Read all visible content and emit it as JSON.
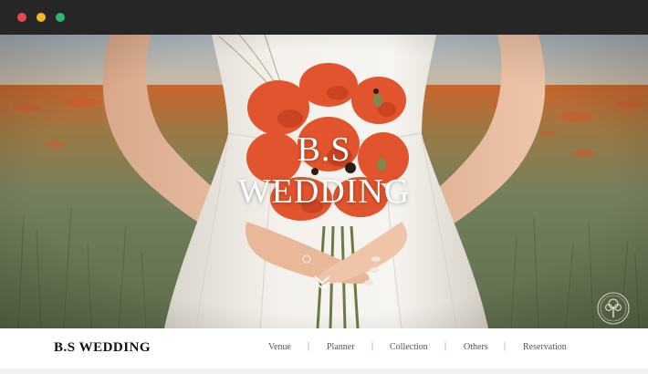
{
  "window": {
    "controls": [
      {
        "name": "close",
        "color": "#e8484a"
      },
      {
        "name": "minimize",
        "color": "#f5b727"
      },
      {
        "name": "zoom",
        "color": "#2fb573"
      }
    ]
  },
  "hero": {
    "title_line1": "B.S",
    "title_line2": "WEDDING",
    "scroll_icon": "chevron-double-down-icon",
    "emblem_icon": "tree-emblem-icon"
  },
  "navbar": {
    "brand": "B.S WEDDING",
    "items": [
      {
        "label": "Venue"
      },
      {
        "label": "Planner"
      },
      {
        "label": "Collection"
      },
      {
        "label": "Others"
      },
      {
        "label": "Reservation"
      }
    ],
    "separator": "|"
  },
  "colors": {
    "titlebar": "#262626",
    "poppy": "#e2542d",
    "field": "#6d7f5e",
    "dress": "#f2efe9"
  }
}
